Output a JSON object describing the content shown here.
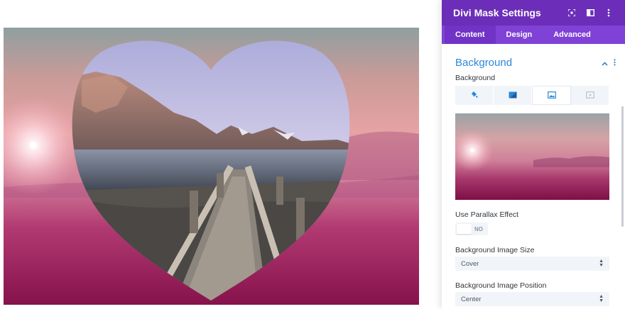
{
  "panel": {
    "title": "Divi Mask Settings",
    "header_icons": [
      "focus-icon",
      "columns-icon",
      "more-vertical-icon"
    ],
    "tabs": [
      {
        "label": "Content",
        "active": true
      },
      {
        "label": "Design",
        "active": false
      },
      {
        "label": "Advanced",
        "active": false
      }
    ],
    "accent_color": "#6c2eb9",
    "tabs_color": "#8041d6",
    "link_color": "#2b87da"
  },
  "section": {
    "title": "Background",
    "collapse_icon": "chevron-up-icon",
    "menu_icon": "more-vertical-icon"
  },
  "background": {
    "label": "Background",
    "types": [
      {
        "icon": "paint-bucket-icon",
        "active": false
      },
      {
        "icon": "gradient-icon",
        "active": false
      },
      {
        "icon": "image-icon",
        "active": true
      },
      {
        "icon": "video-icon",
        "active": false
      }
    ]
  },
  "parallax": {
    "label": "Use Parallax Effect",
    "value": "NO"
  },
  "image_size": {
    "label": "Background Image Size",
    "value": "Cover"
  },
  "image_position": {
    "label": "Background Image Position",
    "value": "Center"
  }
}
